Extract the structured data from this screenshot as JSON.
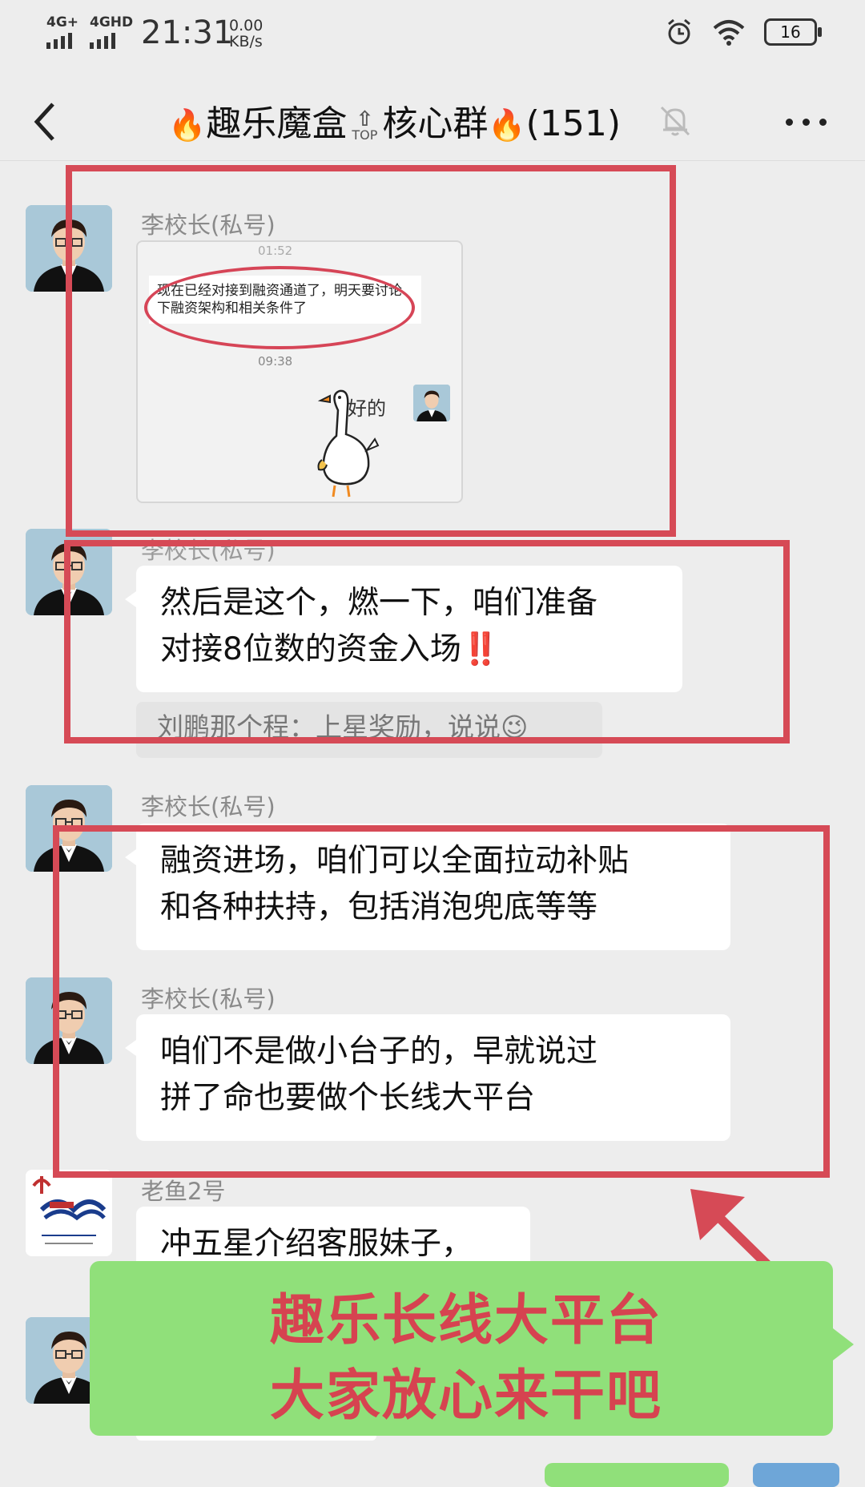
{
  "status_bar": {
    "network_1": "4G+",
    "network_2": "4GHD",
    "time": "21:31",
    "speed_value": "0.00",
    "speed_unit": "KB/s",
    "battery": "16"
  },
  "header": {
    "title_prefix": "趣乐魔盒",
    "top_badge": "TOP",
    "title_suffix": "核心群",
    "member_count": "(151)"
  },
  "messages": [
    {
      "sender": "李校长(私号)",
      "screenshot": {
        "time_top": "01:52",
        "quoted_text": "现在已经对接到融资通道了，明天要讨论下融资架构和相关条件了",
        "time_bottom": "09:38",
        "sticker_text": "好的"
      }
    },
    {
      "sender": "李校长(私号)",
      "text_line1": "然后是这个，燃一下，咱们准备",
      "text_line2": "对接8位数的资金入场",
      "emphasis": "‼️",
      "reply_quote": "刘鹏那个程：上星奖励，说说😉"
    },
    {
      "sender": "李校长(私号)",
      "text_line1": "融资进场，咱们可以全面拉动补贴",
      "text_line2": "和各种扶持，包括消泡兜底等等"
    },
    {
      "sender": "李校长(私号)",
      "text_line1": "咱们不是做小台子的，早就说过",
      "text_line2": "拼了命也要做个长线大平台"
    },
    {
      "sender": "老鱼2号",
      "text_line1": "冲五星介绍客服妹子，"
    }
  ],
  "banner": {
    "line1": "趣乐长线大平台",
    "line2": "大家放心来干吧"
  },
  "colors": {
    "highlight_red": "#d64a56",
    "banner_green": "#90e07a",
    "background": "#ededed"
  }
}
